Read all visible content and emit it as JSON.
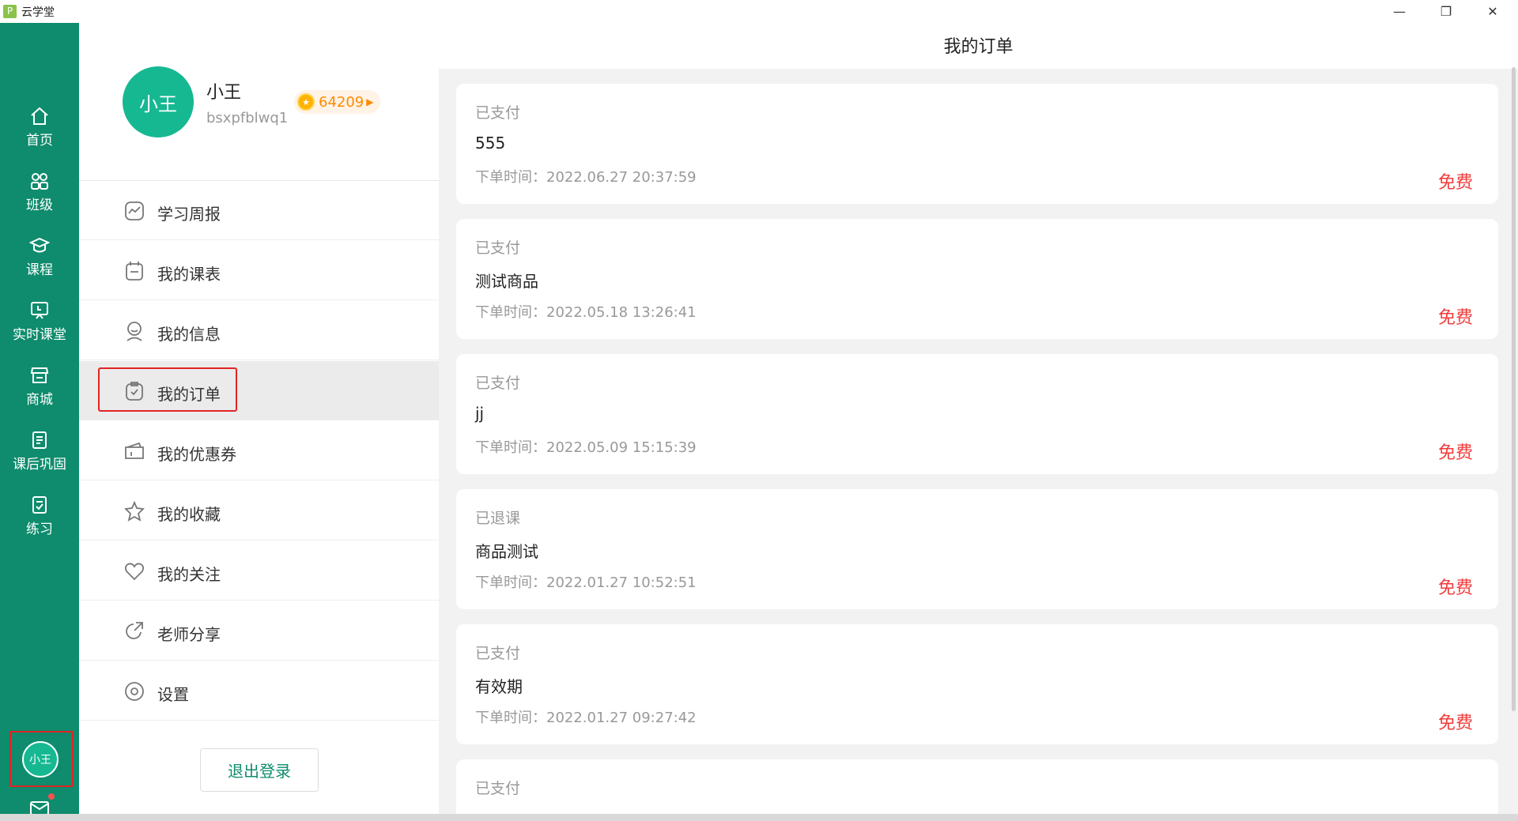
{
  "window": {
    "title": "云学堂",
    "logo_glyph": "P",
    "minimize_glyph": "—",
    "restore_glyph": "❐",
    "close_glyph": "✕"
  },
  "leftnav": {
    "items": [
      {
        "label": "首页",
        "icon": "home-icon"
      },
      {
        "label": "班级",
        "icon": "class-icon"
      },
      {
        "label": "课程",
        "icon": "course-icon"
      },
      {
        "label": "实时课堂",
        "icon": "live-class-icon"
      },
      {
        "label": "商城",
        "icon": "shop-icon"
      },
      {
        "label": "课后巩固",
        "icon": "review-icon"
      },
      {
        "label": "练习",
        "icon": "practice-icon"
      }
    ],
    "user_avatar_text": "小王",
    "mail_icon": "mail-icon"
  },
  "profile": {
    "avatar_text": "小王",
    "name": "小王",
    "user_id": "bsxpfblwq1",
    "points": "64209"
  },
  "menu": {
    "items": [
      {
        "label": "学习周报",
        "icon": "weekly-report-icon"
      },
      {
        "label": "我的课表",
        "icon": "schedule-icon"
      },
      {
        "label": "我的信息",
        "icon": "profile-info-icon"
      },
      {
        "label": "我的订单",
        "icon": "order-icon"
      },
      {
        "label": "我的优惠券",
        "icon": "coupon-icon"
      },
      {
        "label": "我的收藏",
        "icon": "star-icon"
      },
      {
        "label": "我的关注",
        "icon": "heart-icon"
      },
      {
        "label": "老师分享",
        "icon": "share-icon"
      },
      {
        "label": "设置",
        "icon": "settings-icon"
      }
    ],
    "active_index": 3,
    "logout_label": "退出登录"
  },
  "content": {
    "title": "我的订单",
    "orders": [
      {
        "status": "已支付",
        "name": "555",
        "time": "下单时间：2022.06.27 20:37:59",
        "price": "免费"
      },
      {
        "status": "已支付",
        "name": "测试商品",
        "time": "下单时间：2022.05.18 13:26:41",
        "price": "免费"
      },
      {
        "status": "已支付",
        "name": "jj",
        "time": "下单时间：2022.05.09 15:15:39",
        "price": "免费"
      },
      {
        "status": "已退课",
        "name": "商品测试",
        "time": "下单时间：2022.01.27 10:52:51",
        "price": "免费"
      },
      {
        "status": "已支付",
        "name": "有效期",
        "time": "下单时间：2022.01.27 09:27:42",
        "price": "免费"
      },
      {
        "status": "已支付",
        "name": "",
        "time": "",
        "price": ""
      }
    ]
  },
  "colors": {
    "brand_green": "#0e8c6d",
    "avatar_green": "#16b892",
    "price_red": "#f23c3c",
    "highlight_red": "#e02424",
    "points_orange": "#ff8a00"
  }
}
